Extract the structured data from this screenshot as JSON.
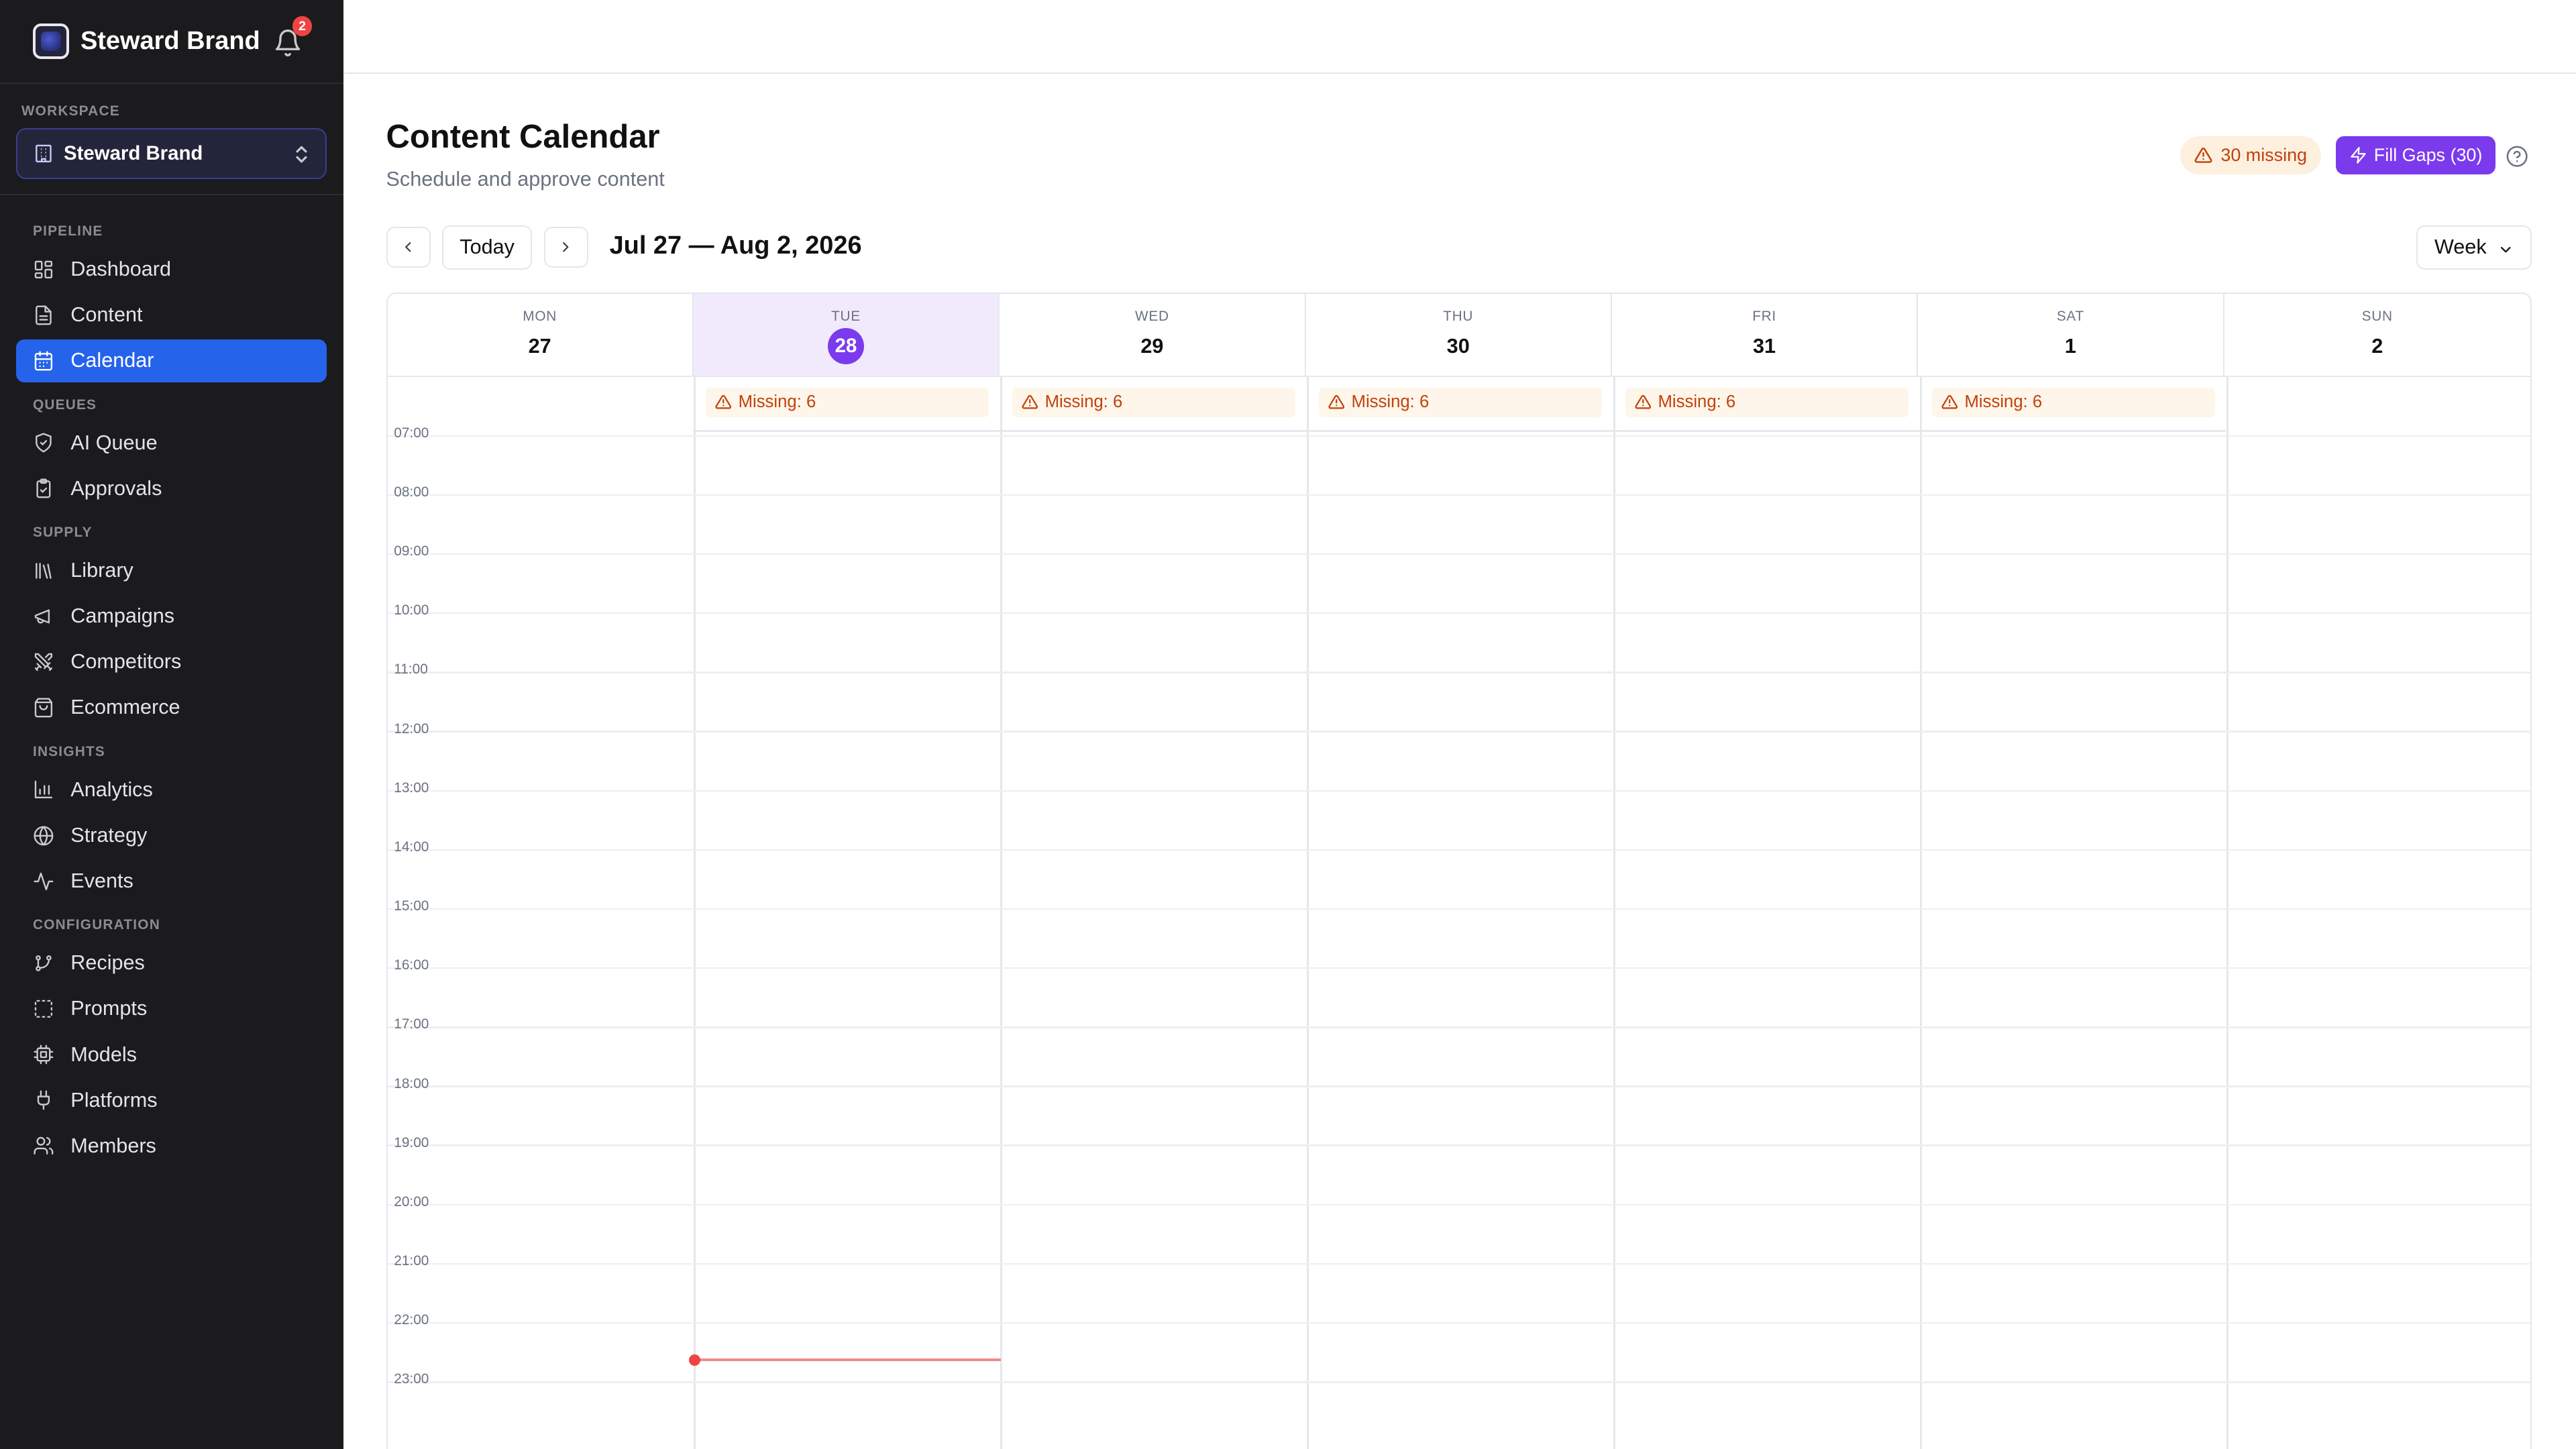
{
  "app": {
    "brand_name": "Steward Brand",
    "notification_count": "2"
  },
  "workspace": {
    "label": "WORKSPACE",
    "selected": "Steward Brand"
  },
  "sidebar": {
    "sections": [
      {
        "label": "PIPELINE",
        "items": [
          {
            "label": "Dashboard",
            "icon": "dashboard-icon",
            "active": false
          },
          {
            "label": "Content",
            "icon": "document-icon",
            "active": false
          },
          {
            "label": "Calendar",
            "icon": "calendar-icon",
            "active": true
          }
        ]
      },
      {
        "label": "QUEUES",
        "items": [
          {
            "label": "AI Queue",
            "icon": "shield-check-icon",
            "active": false
          },
          {
            "label": "Approvals",
            "icon": "clipboard-check-icon",
            "active": false
          }
        ]
      },
      {
        "label": "SUPPLY",
        "items": [
          {
            "label": "Library",
            "icon": "library-icon",
            "active": false
          },
          {
            "label": "Campaigns",
            "icon": "megaphone-icon",
            "active": false
          },
          {
            "label": "Competitors",
            "icon": "swords-icon",
            "active": false
          },
          {
            "label": "Ecommerce",
            "icon": "shopping-bag-icon",
            "active": false
          }
        ]
      },
      {
        "label": "INSIGHTS",
        "items": [
          {
            "label": "Analytics",
            "icon": "bar-chart-icon",
            "active": false
          },
          {
            "label": "Strategy",
            "icon": "globe-icon",
            "active": false
          },
          {
            "label": "Events",
            "icon": "activity-icon",
            "active": false
          }
        ]
      },
      {
        "label": "CONFIGURATION",
        "items": [
          {
            "label": "Recipes",
            "icon": "git-branch-icon",
            "active": false
          },
          {
            "label": "Prompts",
            "icon": "dashed-square-icon",
            "active": false
          },
          {
            "label": "Models",
            "icon": "cpu-icon",
            "active": false
          },
          {
            "label": "Platforms",
            "icon": "plug-icon",
            "active": false
          },
          {
            "label": "Members",
            "icon": "users-icon",
            "active": false
          }
        ]
      }
    ]
  },
  "header": {
    "title": "Content Calendar",
    "subtitle": "Schedule and approve content",
    "missing_badge": "30 missing",
    "fill_gaps_button": "Fill Gaps (30)"
  },
  "toolbar": {
    "today_label": "Today",
    "date_range": "Jul 27 — Aug 2, 2026",
    "view_select": "Week"
  },
  "calendar": {
    "days": [
      {
        "dow": "MON",
        "date": "27",
        "today": false,
        "missing": ""
      },
      {
        "dow": "TUE",
        "date": "28",
        "today": true,
        "missing": "Missing: 6"
      },
      {
        "dow": "WED",
        "date": "29",
        "today": false,
        "missing": "Missing: 6"
      },
      {
        "dow": "THU",
        "date": "30",
        "today": false,
        "missing": "Missing: 6"
      },
      {
        "dow": "FRI",
        "date": "31",
        "today": false,
        "missing": "Missing: 6"
      },
      {
        "dow": "SAT",
        "date": "1",
        "today": false,
        "missing": "Missing: 6"
      },
      {
        "dow": "SUN",
        "date": "2",
        "today": false,
        "missing": ""
      }
    ],
    "hours": [
      "07:00",
      "08:00",
      "09:00",
      "10:00",
      "11:00",
      "12:00",
      "13:00",
      "14:00",
      "15:00",
      "16:00",
      "17:00",
      "18:00",
      "19:00",
      "20:00",
      "21:00",
      "22:00",
      "23:00"
    ],
    "current_time": "23:00"
  },
  "colors": {
    "accent": "#7c3aed",
    "active_nav": "#2563eb",
    "warning": "#c2410c",
    "now_line": "#ef4444"
  }
}
